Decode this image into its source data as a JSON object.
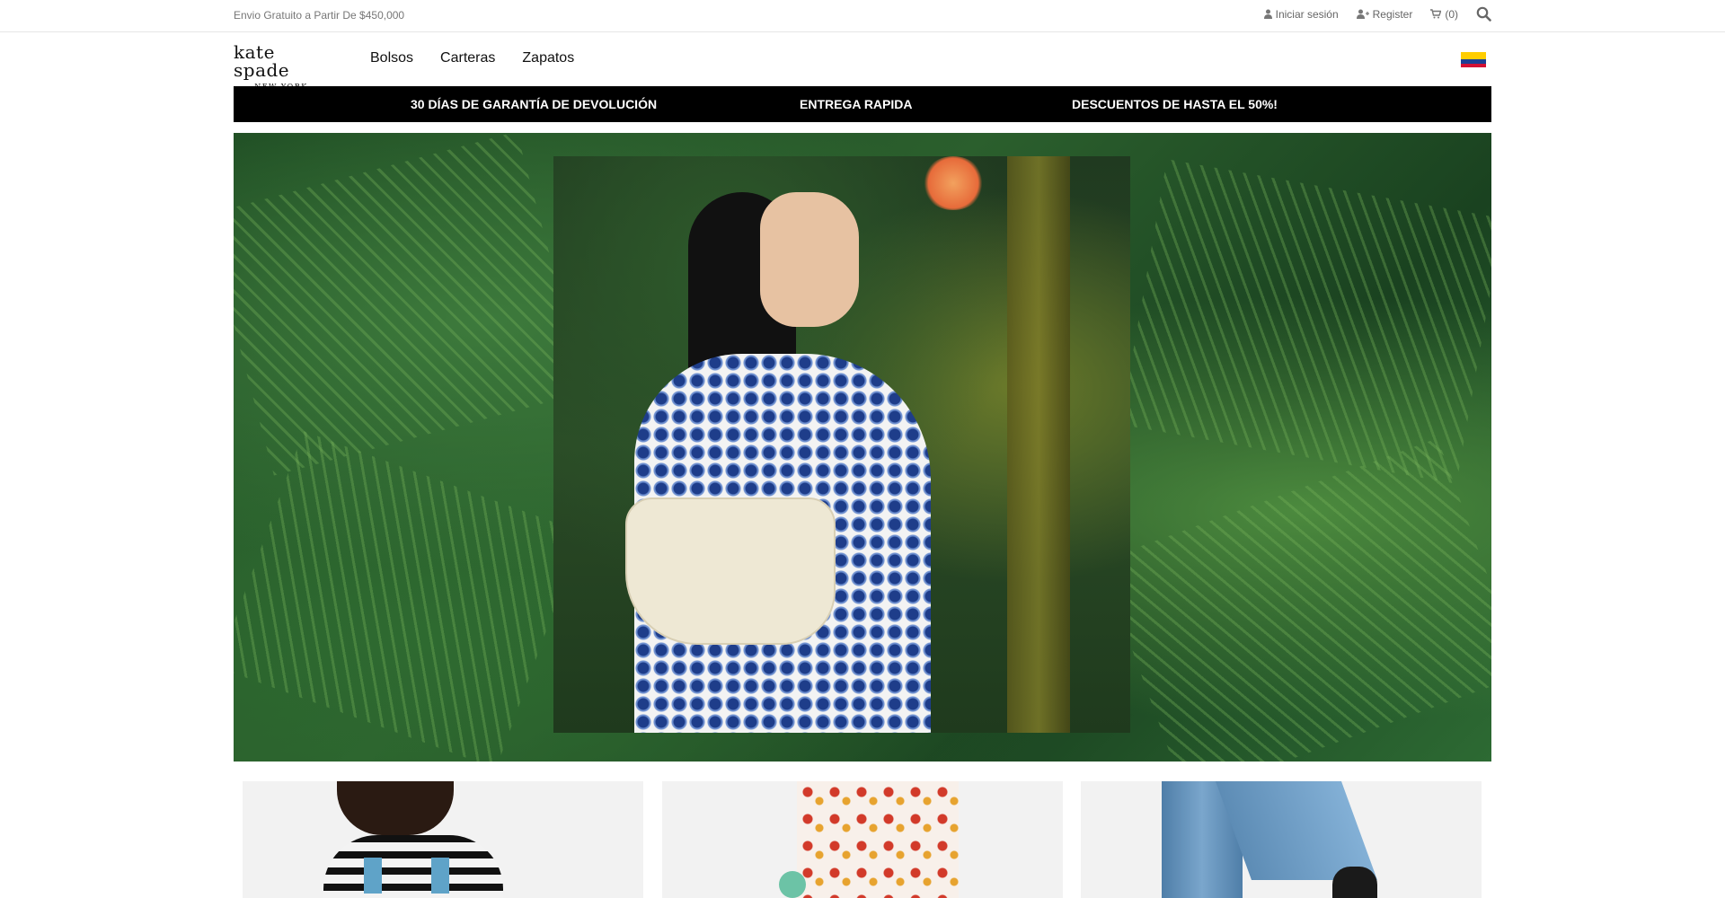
{
  "topbar": {
    "shipping_text": "Envio Gratuito a Partir De $450,000",
    "login_label": "Iniciar sesión",
    "register_label": "Register",
    "cart_count": "(0)"
  },
  "header": {
    "logo_main": "kate spade",
    "logo_sub": "NEW YORK",
    "nav": [
      "Bolsos",
      "Carteras",
      "Zapatos"
    ],
    "flag": "colombia-flag-icon"
  },
  "promo": {
    "items": [
      "30 DÍAS DE GARANTÍA DE DEVOLUCIÓN",
      "ENTREGA RAPIDA",
      "DESCUENTOS DE HASTA EL 50%!"
    ]
  },
  "colors": {
    "promo_bg": "#000000",
    "promo_text": "#ffffff",
    "muted_text": "#777777"
  }
}
